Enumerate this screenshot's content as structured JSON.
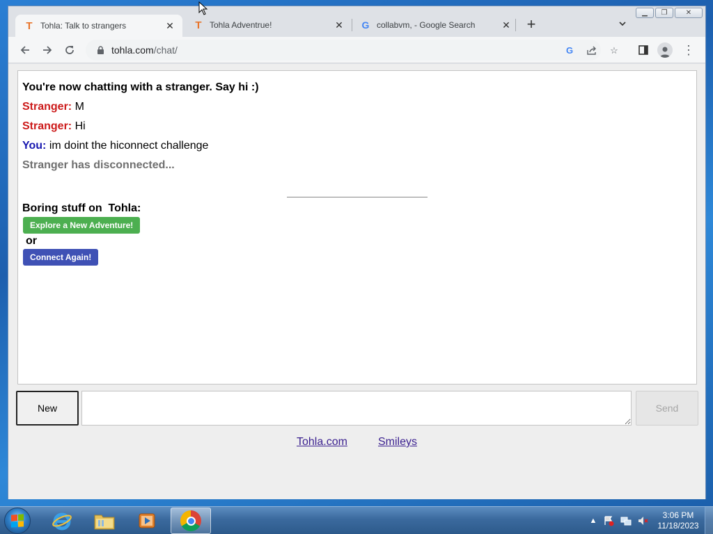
{
  "browser": {
    "tabs": [
      {
        "title": "Tohla: Talk to strangers",
        "favicon": "T",
        "active": true
      },
      {
        "title": "Tohla Adventrue!",
        "favicon": "T",
        "active": false
      },
      {
        "title": "collabvm, - Google Search",
        "favicon": "G",
        "active": false
      }
    ],
    "new_tab_label": "+",
    "url_host": "tohla.com",
    "url_path": "/chat/"
  },
  "chat": {
    "intro": "You're now chatting with a stranger. Say hi :)",
    "messages": [
      {
        "sender": "Stranger:",
        "text": "M"
      },
      {
        "sender": "Stranger:",
        "text": "Hi"
      },
      {
        "sender": "You:",
        "text": "im doint the hiconnect challenge"
      }
    ],
    "disconnected": "Stranger has disconnected...",
    "boring_text": "Boring stuff on  Tohla:",
    "explore_button": "Explore a New Adventure!",
    "or_text": "or",
    "connect_button": "Connect Again!"
  },
  "controls": {
    "new_button": "New",
    "message_value": "",
    "send_button": "Send"
  },
  "footer": {
    "links": [
      "Tohla.com",
      "Smileys"
    ]
  },
  "taskbar": {
    "time": "3:06 PM",
    "date": "11/18/2023",
    "apps": [
      "internet-explorer-icon",
      "file-explorer-icon",
      "media-player-icon",
      "chrome-icon"
    ]
  },
  "colors": {
    "stranger": "#cc1a1a",
    "you": "#1818b0",
    "explore_button": "#4caf50",
    "connect_button": "#3f51b5"
  }
}
